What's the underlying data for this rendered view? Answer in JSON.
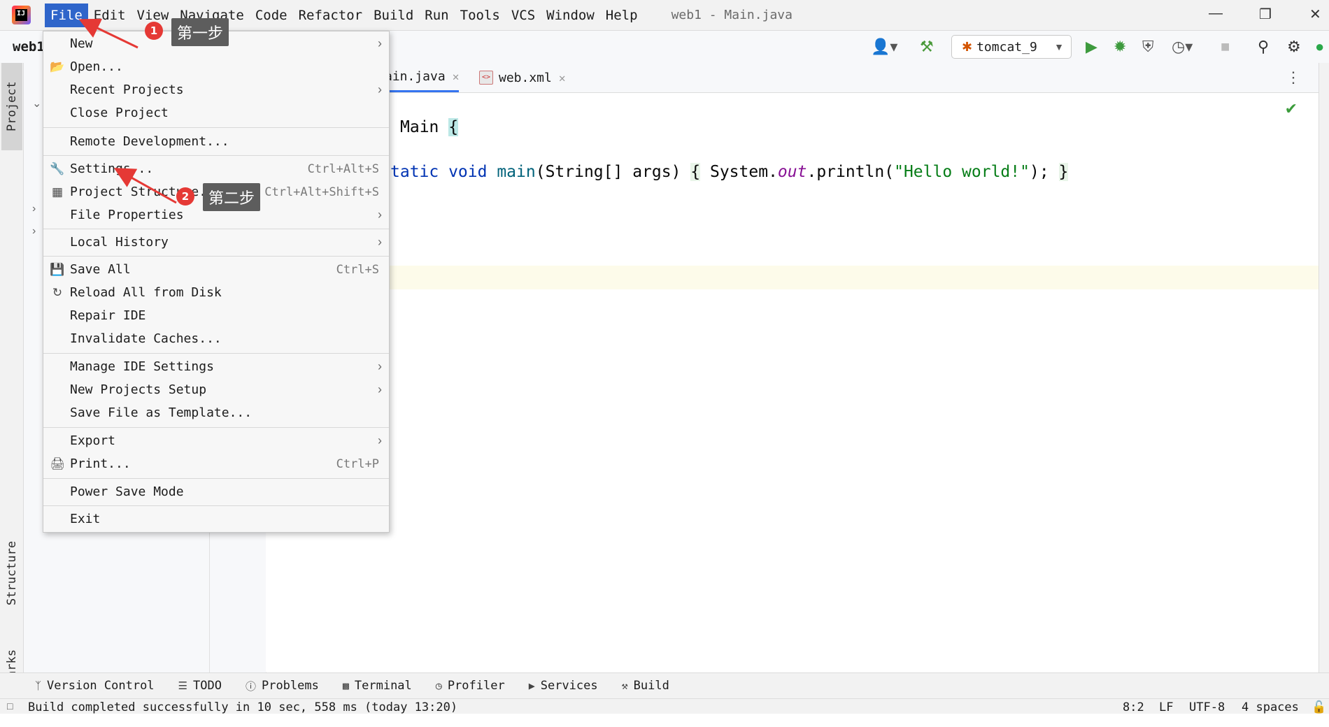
{
  "menubar": {
    "items": [
      "File",
      "Edit",
      "View",
      "Navigate",
      "Code",
      "Refactor",
      "Build",
      "Run",
      "Tools",
      "VCS",
      "Window",
      "Help"
    ],
    "active_item": "File",
    "window_title": "web1 - Main.java"
  },
  "toolbar": {
    "project_name": "web1",
    "run_config": "tomcat_9"
  },
  "editor": {
    "tabs": [
      {
        "label": "Main.java",
        "visible_label": "ain.java",
        "active": true
      },
      {
        "label": "web.xml",
        "active": false
      }
    ],
    "code": {
      "line1_class_name": "Main",
      "line2_partial": "tatic void main(String[] args) { System.out.println(\"Hello world!\"); }"
    }
  },
  "left_stripe": {
    "tabs": [
      "Project",
      "Structure",
      "Bookmarks"
    ]
  },
  "file_menu": {
    "items": [
      {
        "label": "New",
        "submenu": true
      },
      {
        "label": "Open...",
        "icon": "folder-icon"
      },
      {
        "label": "Recent Projects",
        "submenu": true
      },
      {
        "label": "Close Project"
      },
      {
        "label": "Remote Development..."
      },
      {
        "label": "Settings...",
        "shortcut": "Ctrl+Alt+S",
        "icon": "wrench-icon"
      },
      {
        "label": "Project Structure...",
        "shortcut": "Ctrl+Alt+Shift+S",
        "icon": "project-structure-icon"
      },
      {
        "label": "File Properties",
        "submenu": true
      },
      {
        "label": "Local History",
        "submenu": true
      },
      {
        "label": "Save All",
        "shortcut": "Ctrl+S",
        "icon": "save-icon"
      },
      {
        "label": "Reload All from Disk",
        "icon": "reload-icon"
      },
      {
        "label": "Repair IDE"
      },
      {
        "label": "Invalidate Caches..."
      },
      {
        "label": "Manage IDE Settings",
        "submenu": true
      },
      {
        "label": "New Projects Setup",
        "submenu": true
      },
      {
        "label": "Save File as Template..."
      },
      {
        "label": "Export",
        "submenu": true
      },
      {
        "label": "Print...",
        "shortcut": "Ctrl+P",
        "icon": "print-icon"
      },
      {
        "label": "Power Save Mode"
      },
      {
        "label": "Exit"
      }
    ]
  },
  "annotations": {
    "step1_badge": "1",
    "step1_label": "第一步",
    "step2_badge": "2",
    "step2_label": "第二步"
  },
  "bottom_bar": {
    "tabs": [
      "Version Control",
      "TODO",
      "Problems",
      "Terminal",
      "Profiler",
      "Services",
      "Build"
    ]
  },
  "status_bar": {
    "message": "Build completed successfully in 10 sec, 558 ms (today 13:20)",
    "position": "8:2",
    "line_separator": "LF",
    "encoding": "UTF-8",
    "indent": "4 spaces"
  },
  "colors": {
    "menu_active": "#2f65ca",
    "annotation_red": "#e53935",
    "callout_bg": "#5d5d5d"
  }
}
